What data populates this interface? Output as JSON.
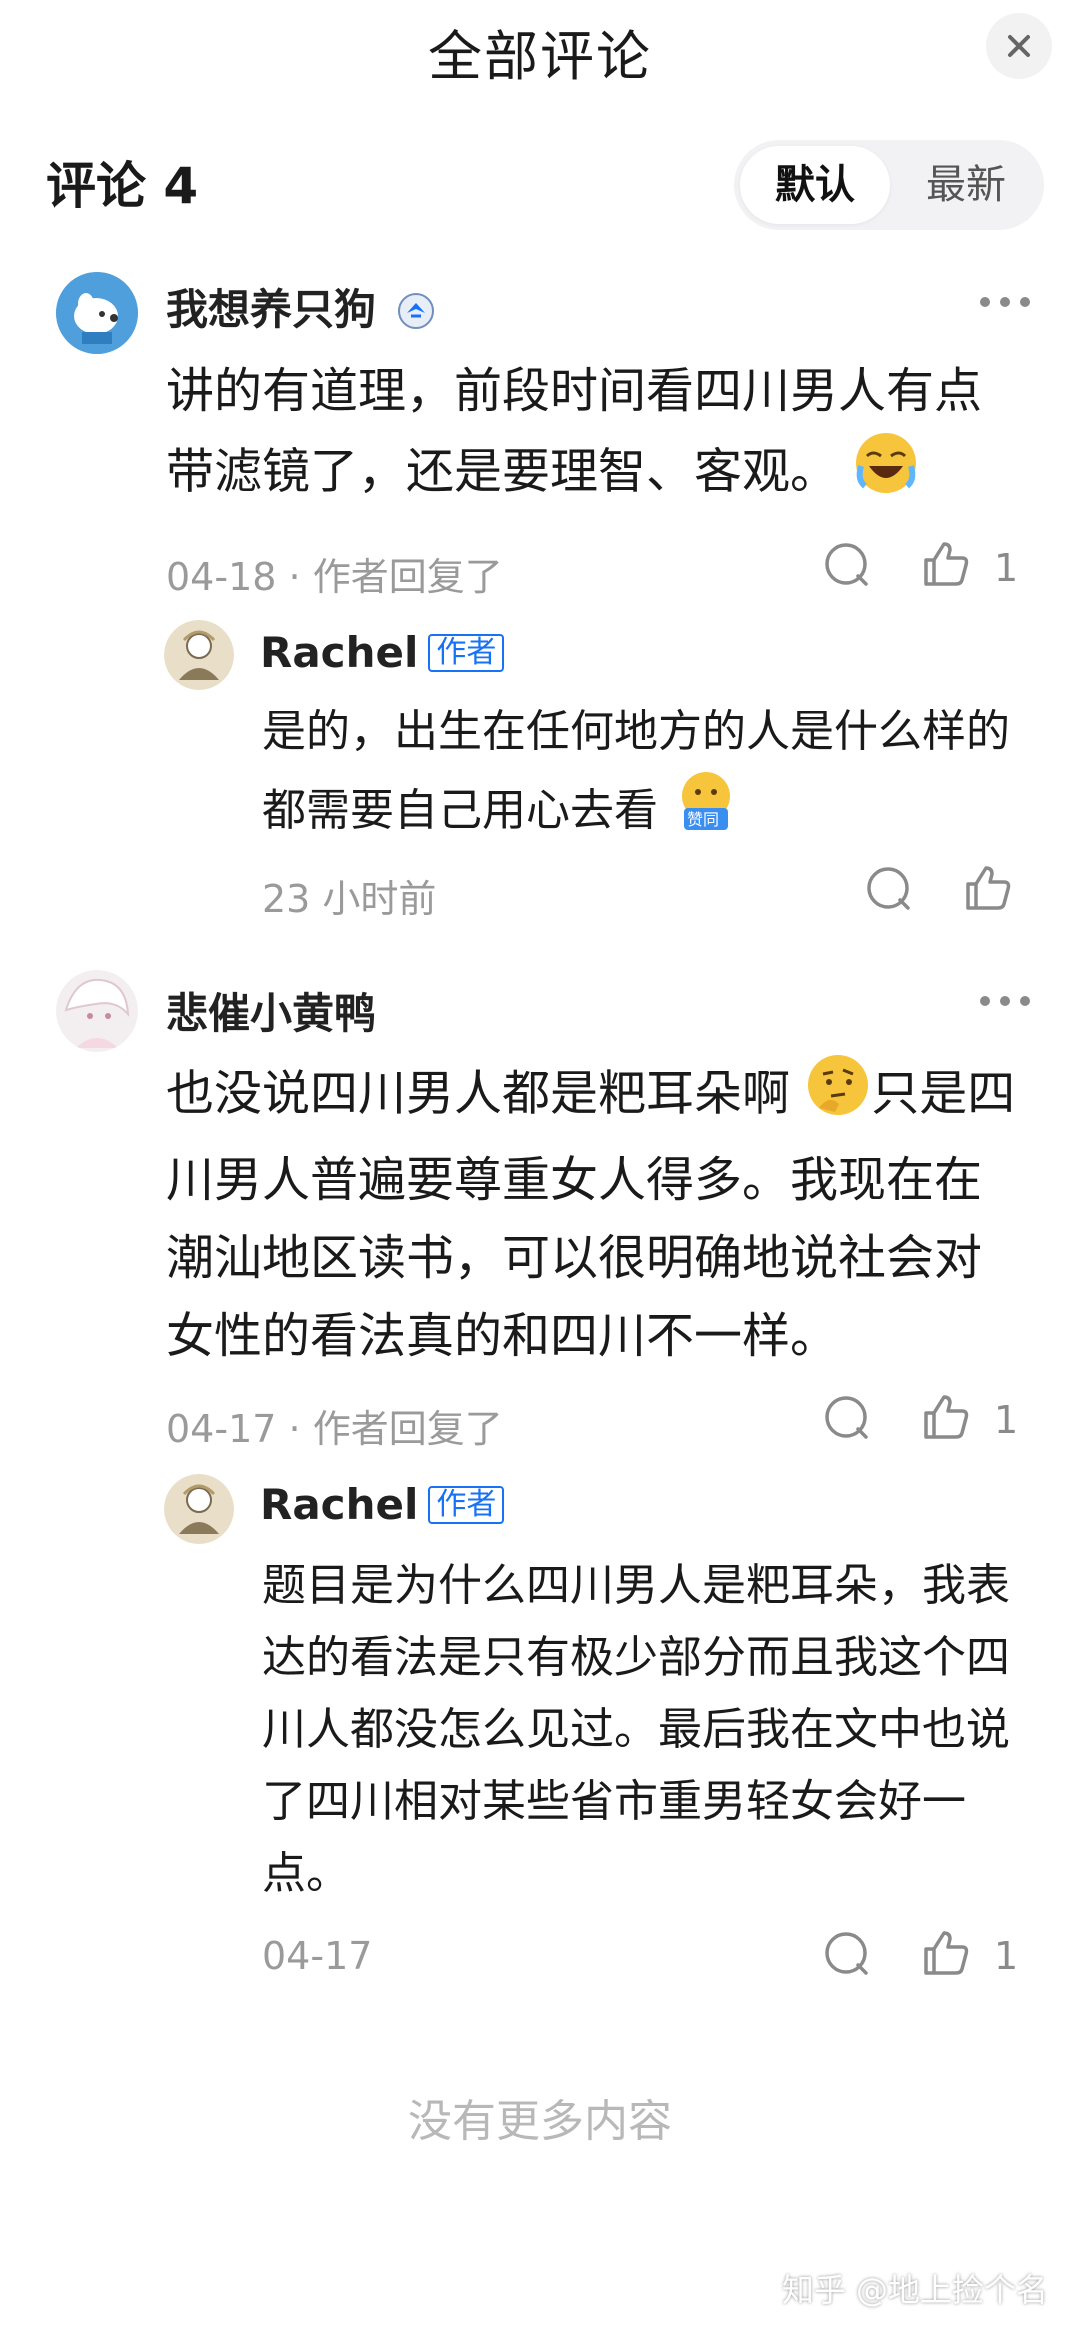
{
  "header": {
    "title": "全部评论"
  },
  "comments_count_label": "评论 4",
  "sort": {
    "default_label": "默认",
    "newest_label": "最新"
  },
  "comments": [
    {
      "name": "我想养只狗",
      "text": "讲的有道理，前段时间看四川男人有点带滤镜了，还是要理智、客观。",
      "date": "04-18",
      "reply_note": "作者回复了",
      "likes": "1",
      "reply": {
        "name": "Rachel",
        "badge": "作者",
        "text": "是的，出生在任何地方的人是什么样的都需要自己用心去看",
        "emoji_label": "赞同",
        "time": "23 小时前"
      }
    },
    {
      "name": "悲催小黄鸭",
      "text": "也没说四川男人都是粑耳朵啊",
      "text2": "只是四川男人普遍要尊重女人得多。我现在在潮汕地区读书，可以很明确地说社会对女性的看法真的和四川不一样。",
      "date": "04-17",
      "reply_note": "作者回复了",
      "likes": "1",
      "reply": {
        "name": "Rachel",
        "badge": "作者",
        "text": "题目是为什么四川男人是粑耳朵，我表达的看法是只有极少部分而且我这个四川人都没怎么见过。最后我在文中也说了四川相对某些省市重男轻女会好一点。",
        "time": "04-17",
        "likes": "1"
      }
    }
  ],
  "footer_note": "没有更多内容",
  "watermark": "知乎 @地上捡个名",
  "colors": {
    "accent": "#1772f6",
    "muted": "#9a9a9a"
  }
}
